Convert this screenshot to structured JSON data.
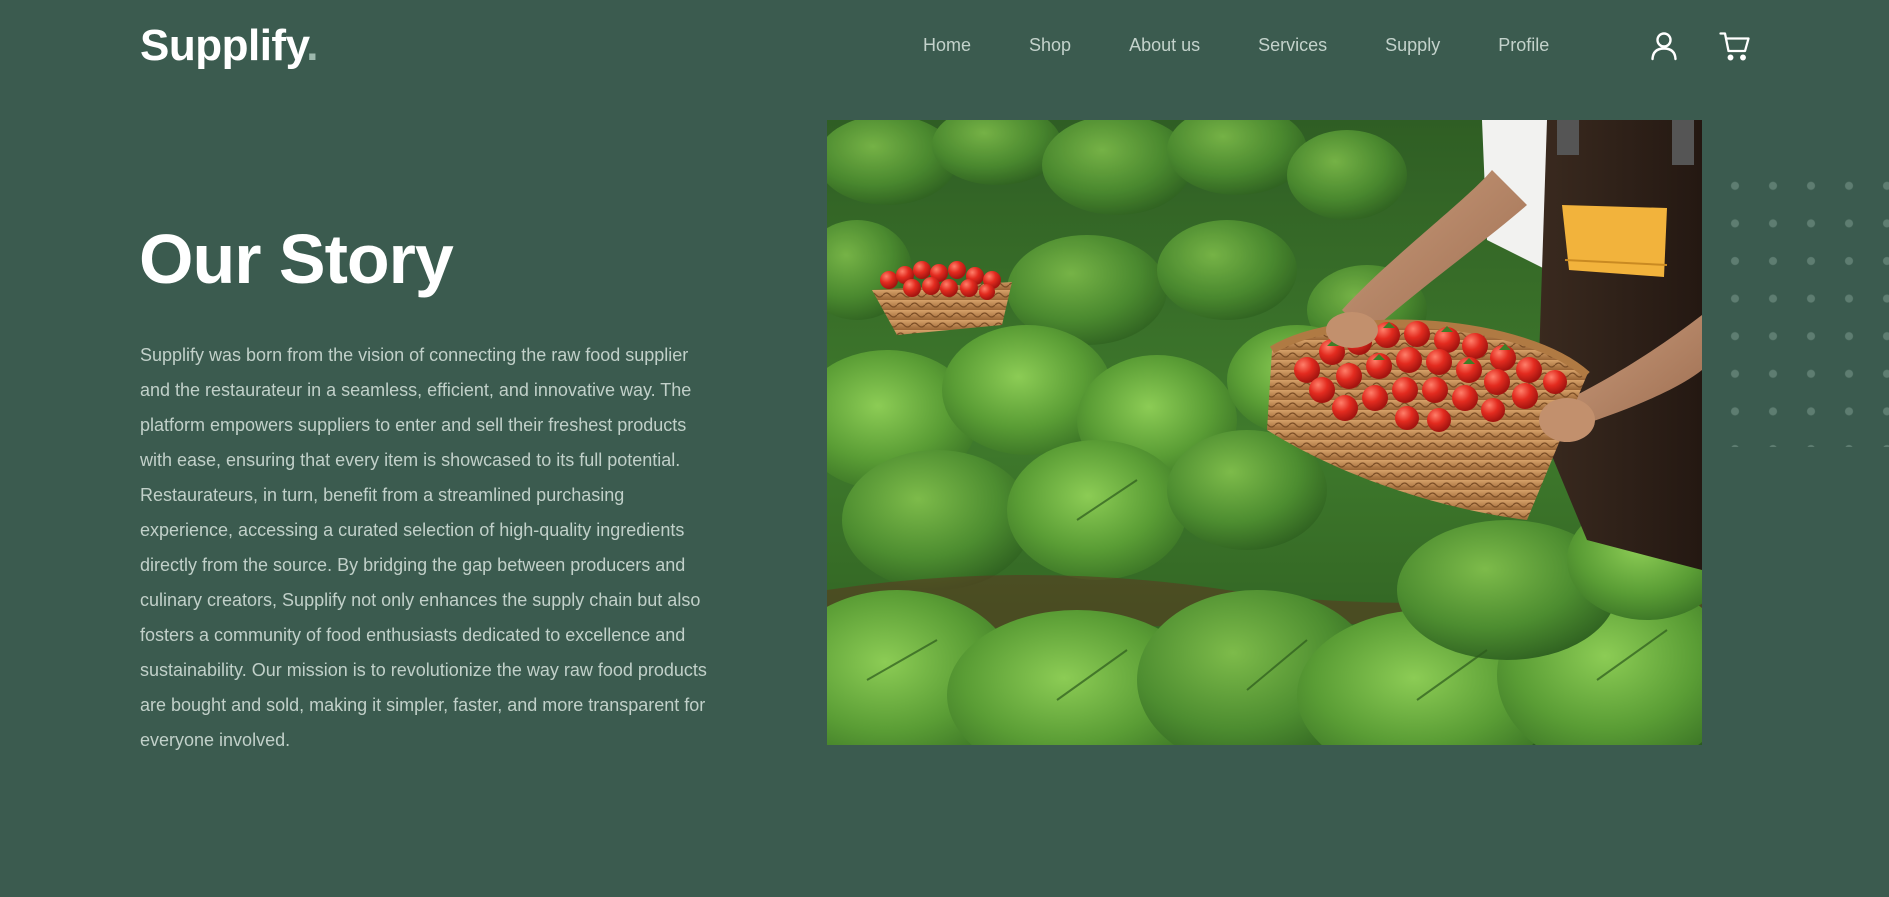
{
  "brand": {
    "name": "Supplify",
    "dot": "."
  },
  "nav": {
    "items": [
      {
        "label": "Home"
      },
      {
        "label": "Shop"
      },
      {
        "label": "About us"
      },
      {
        "label": "Services"
      },
      {
        "label": "Supply"
      },
      {
        "label": "Profile"
      }
    ]
  },
  "header_icons": [
    "user-icon",
    "cart-icon"
  ],
  "story": {
    "title": "Our Story",
    "body": "Supplify was born from the vision of connecting the raw food supplier and the restaurateur in a seamless, efficient, and innovative way. The platform empowers suppliers to enter and sell their freshest products with ease, ensuring that every item is showcased to its full potential. Restaurateurs, in turn, benefit from a streamlined purchasing experience, accessing a curated selection of high-quality ingredients directly from the source. By bridging the gap between producers and culinary creators, Supplify not only enhances the supply chain but also fosters a community of food enthusiasts dedicated to excellence and sustainability. Our mission is to revolutionize the way raw food products are bought and sold, making it simpler, faster, and more transparent for everyone involved."
  },
  "colors": {
    "background": "#3b5b4f",
    "heading": "#ffffff",
    "body_text": "#c1d0c9",
    "nav_text": "#c3d2cb",
    "dot_grid": "#5e7d71"
  }
}
